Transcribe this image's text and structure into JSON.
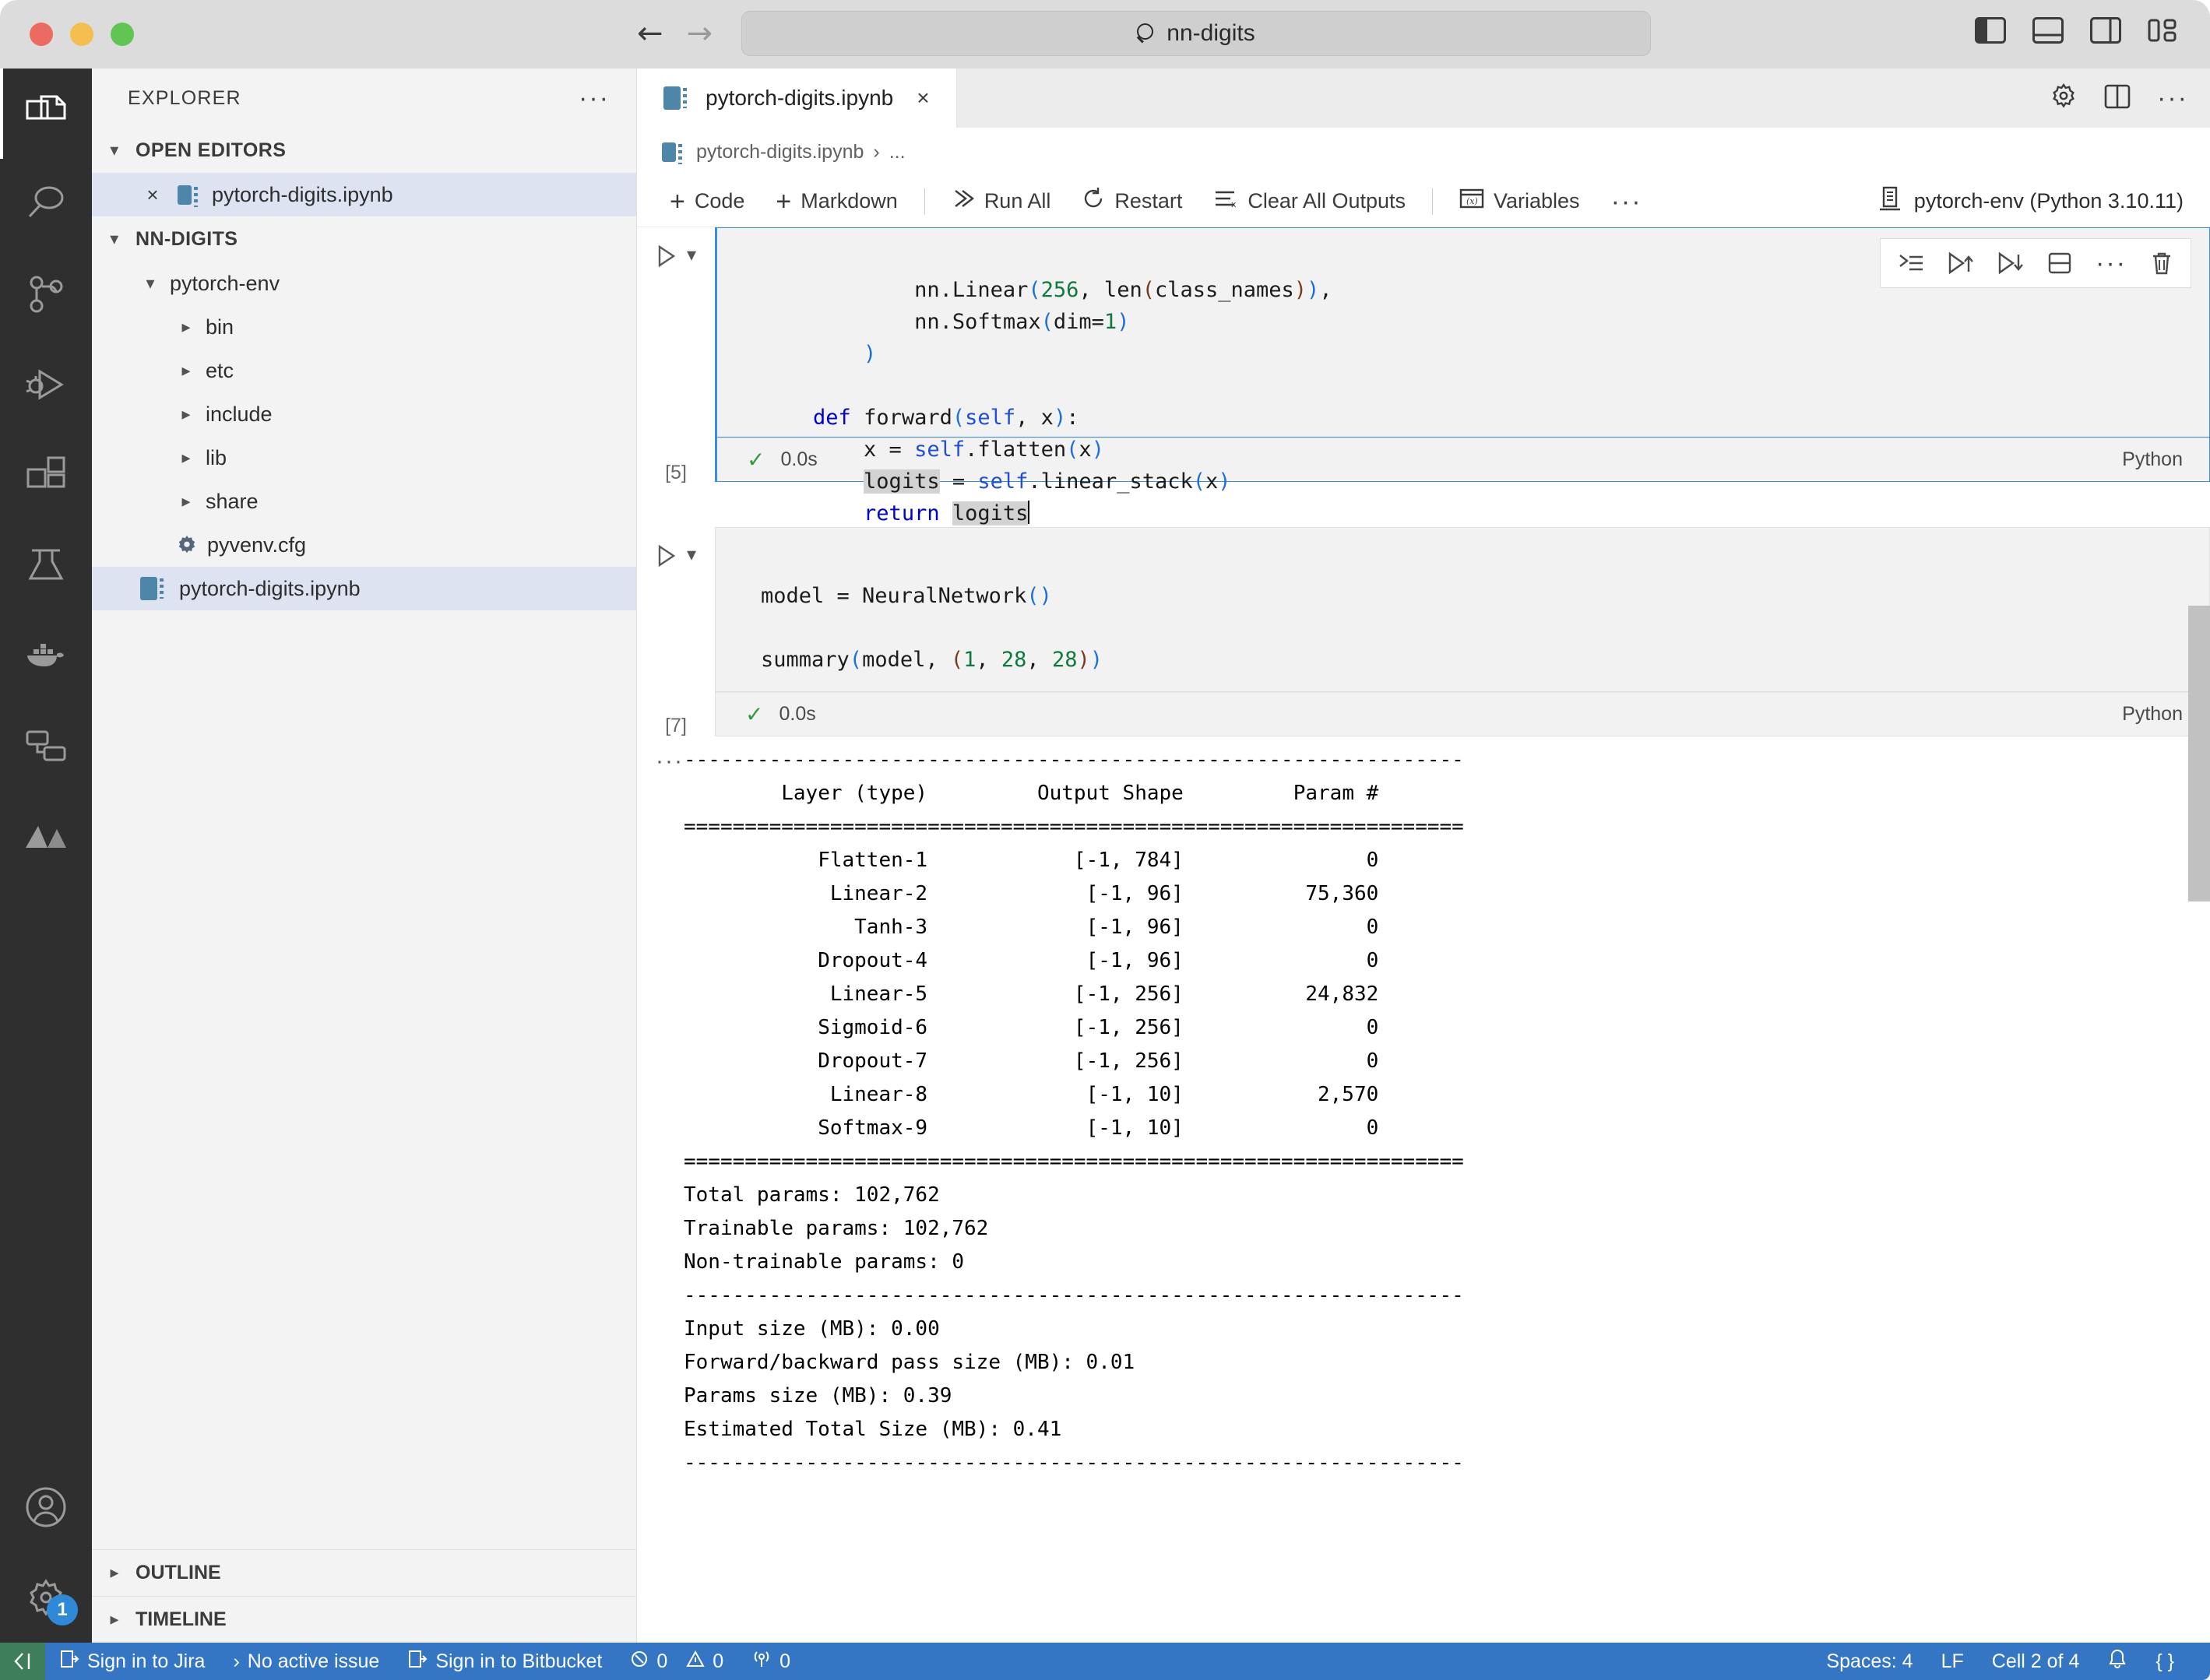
{
  "titlebar": {
    "search_value": "nn-digits",
    "back_icon": "arrow-left-icon",
    "forward_icon": "arrow-right-icon",
    "layout_icons": [
      "toggle-primary-sidebar-icon",
      "toggle-panel-icon",
      "toggle-secondary-sidebar-icon",
      "customize-layout-icon"
    ]
  },
  "activitybar": {
    "items": [
      {
        "name": "explorer",
        "icon": "files-icon",
        "active": true
      },
      {
        "name": "search",
        "icon": "search-icon",
        "active": false
      },
      {
        "name": "source-control",
        "icon": "source-control-icon",
        "active": false
      },
      {
        "name": "run-and-debug",
        "icon": "run-debug-icon",
        "active": false
      },
      {
        "name": "extensions",
        "icon": "extensions-icon",
        "active": false
      },
      {
        "name": "testing",
        "icon": "beaker-icon",
        "active": false
      },
      {
        "name": "docker",
        "icon": "docker-whale-icon",
        "active": false
      },
      {
        "name": "remote-explorer",
        "icon": "remote-explorer-icon",
        "active": false
      },
      {
        "name": "azure",
        "icon": "azure-icon",
        "active": false
      }
    ],
    "bottom": [
      {
        "name": "accounts",
        "icon": "account-icon"
      },
      {
        "name": "manage",
        "icon": "gear-icon",
        "badge": "1"
      }
    ]
  },
  "sidebar": {
    "title": "EXPLORER",
    "more_label": "···",
    "open_editors": {
      "label": "OPEN EDITORS",
      "expanded": true,
      "items": [
        {
          "label": "pytorch-digits.ipynb",
          "icon": "notebook-icon",
          "selected": true,
          "close": "×"
        }
      ]
    },
    "workspace": {
      "label": "NN-DIGITS",
      "expanded": true,
      "items": [
        {
          "label": "pytorch-env",
          "type": "folder",
          "expanded": true,
          "indent": 1
        },
        {
          "label": "bin",
          "type": "folder",
          "expanded": false,
          "indent": 2
        },
        {
          "label": "etc",
          "type": "folder",
          "expanded": false,
          "indent": 2
        },
        {
          "label": "include",
          "type": "folder",
          "expanded": false,
          "indent": 2
        },
        {
          "label": "lib",
          "type": "folder",
          "expanded": false,
          "indent": 2
        },
        {
          "label": "share",
          "type": "folder",
          "expanded": false,
          "indent": 2
        },
        {
          "label": "pyvenv.cfg",
          "type": "file-cfg",
          "indent": 2
        },
        {
          "label": "pytorch-digits.ipynb",
          "type": "file-notebook",
          "indent": 1,
          "selected": true
        }
      ]
    },
    "panels": [
      {
        "label": "OUTLINE",
        "expanded": false
      },
      {
        "label": "TIMELINE",
        "expanded": false
      }
    ]
  },
  "editor": {
    "tab": {
      "label": "pytorch-digits.ipynb",
      "close": "×",
      "icon": "notebook-icon"
    },
    "tab_actions": [
      {
        "name": "settings",
        "icon": "gear-icon"
      },
      {
        "name": "split-editor",
        "icon": "split-editor-icon"
      },
      {
        "name": "more-actions",
        "icon": "ellipsis-icon"
      }
    ],
    "breadcrumb": {
      "file": "pytorch-digits.ipynb",
      "separator": "›",
      "rest": "..."
    },
    "toolbar": {
      "add_code": "Code",
      "add_markdown": "Markdown",
      "run_all": "Run All",
      "restart": "Restart",
      "clear_all_outputs": "Clear All Outputs",
      "variables": "Variables",
      "more": "···",
      "kernel": "pytorch-env (Python 3.10.11)"
    }
  },
  "cells": [
    {
      "execution_count": "[5]",
      "status_icon": "success-check-icon",
      "duration": "0.0s",
      "language": "Python",
      "focused": true,
      "toolbar_icons": [
        "run-by-line-icon",
        "execute-above-cells-icon",
        "execute-cell-and-below-icon",
        "split-cell-icon",
        "more-icon",
        "delete-cell-icon"
      ],
      "code_lines": [
        "            nn.Linear(256, len(class_names)),",
        "            nn.Softmax(dim=1)",
        "        )",
        "",
        "    def forward(self, x):",
        "        x = self.flatten(x)",
        "        logits = self.linear_stack(x)",
        "        return logits"
      ]
    },
    {
      "execution_count": "[7]",
      "status_icon": "success-check-icon",
      "duration": "0.0s",
      "language": "Python",
      "focused": false,
      "code_lines": [
        "model = NeuralNetwork()",
        "",
        "summary(model, (1, 28, 28))"
      ]
    }
  ],
  "output": {
    "dots": "···",
    "divider_dash": "----------------------------------------------------------------",
    "divider_equals": "================================================================",
    "headers": [
      "Layer (type)",
      "Output Shape",
      "Param #"
    ],
    "rows": [
      {
        "layer": "Flatten-1",
        "shape": "[-1, 784]",
        "params": "0"
      },
      {
        "layer": "Linear-2",
        "shape": "[-1, 96]",
        "params": "75,360"
      },
      {
        "layer": "Tanh-3",
        "shape": "[-1, 96]",
        "params": "0"
      },
      {
        "layer": "Dropout-4",
        "shape": "[-1, 96]",
        "params": "0"
      },
      {
        "layer": "Linear-5",
        "shape": "[-1, 256]",
        "params": "24,832"
      },
      {
        "layer": "Sigmoid-6",
        "shape": "[-1, 256]",
        "params": "0"
      },
      {
        "layer": "Dropout-7",
        "shape": "[-1, 256]",
        "params": "0"
      },
      {
        "layer": "Linear-8",
        "shape": "[-1, 10]",
        "params": "2,570"
      },
      {
        "layer": "Softmax-9",
        "shape": "[-1, 10]",
        "params": "0"
      }
    ],
    "totals": [
      "Total params: 102,762",
      "Trainable params: 102,762",
      "Non-trainable params: 0"
    ],
    "sizes": [
      "Input size (MB): 0.00",
      "Forward/backward pass size (MB): 0.01",
      "Params size (MB): 0.39",
      "Estimated Total Size (MB): 0.41"
    ]
  },
  "statusbar": {
    "remote_icon": "remote-window-icon",
    "left_items": [
      {
        "name": "jira",
        "icon": "jira-icon",
        "label": "Sign in to Jira"
      },
      {
        "name": "active-issue",
        "icon": "chevron-right-icon",
        "label": "No active issue"
      },
      {
        "name": "bitbucket",
        "icon": "bitbucket-icon",
        "label": "Sign in to Bitbucket"
      },
      {
        "name": "errors",
        "icon": "error-icon",
        "label": "0"
      },
      {
        "name": "warnings",
        "icon": "warning-icon",
        "label": "0"
      },
      {
        "name": "ports",
        "icon": "radio-tower-icon",
        "label": "0"
      }
    ],
    "right_items": [
      {
        "name": "indentation",
        "label": "Spaces: 4"
      },
      {
        "name": "eol",
        "label": "LF"
      },
      {
        "name": "cell-position",
        "label": "Cell 2 of 4"
      },
      {
        "name": "notifications",
        "icon": "bell-icon",
        "label": ""
      },
      {
        "name": "json-mode",
        "icon": "braces-icon",
        "label": "{ }"
      }
    ]
  },
  "colors": {
    "accent_blue": "#3476c4",
    "activity_bar": "#2f2f2f",
    "sidebar_bg": "#f3f3f3",
    "cell_bg": "#f2f2f2",
    "focus_border": "#3c8ce0",
    "success_green": "#2e9b3f"
  }
}
